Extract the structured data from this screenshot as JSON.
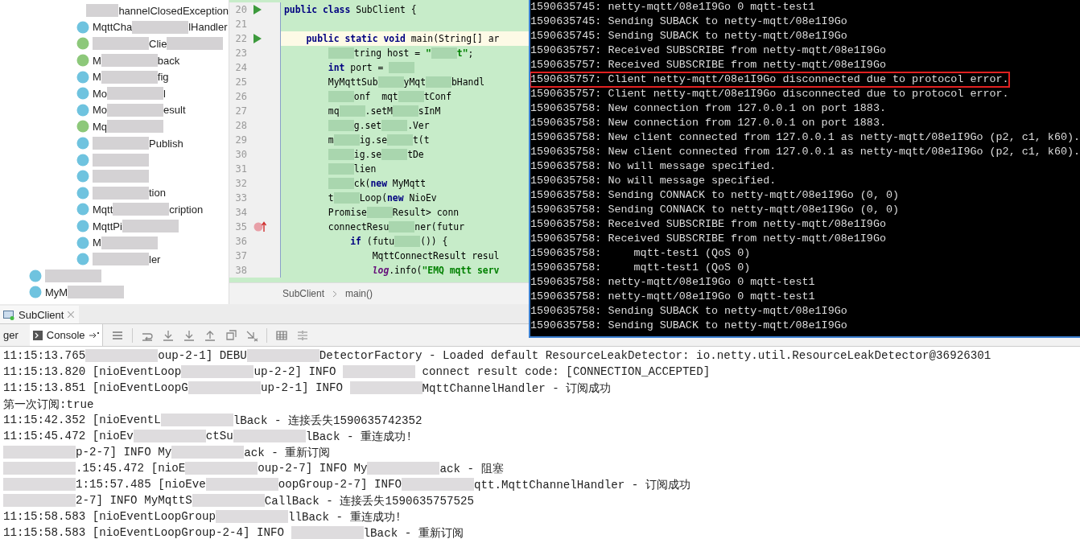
{
  "project_tree": {
    "nested_items": [
      {
        "kind": "none",
        "segments": [
          {
            "kind": "blur"
          },
          {
            "kind": "text",
            "text": "hannelClosedException"
          }
        ]
      },
      {
        "kind": "class",
        "segments": [
          {
            "kind": "text",
            "text": "MqttCha"
          },
          {
            "kind": "blur"
          },
          {
            "kind": "text",
            "text": "lHandler"
          }
        ]
      },
      {
        "kind": "interface",
        "segments": [
          {
            "kind": "blur"
          },
          {
            "kind": "text",
            "text": "Clie"
          },
          {
            "kind": "blur"
          }
        ]
      },
      {
        "kind": "interface",
        "segments": [
          {
            "kind": "text",
            "text": "M"
          },
          {
            "kind": "blur"
          },
          {
            "kind": "text",
            "text": "back"
          }
        ]
      },
      {
        "kind": "class",
        "segments": [
          {
            "kind": "text",
            "text": "M"
          },
          {
            "kind": "blur"
          },
          {
            "kind": "text",
            "text": "fig"
          }
        ]
      },
      {
        "kind": "class",
        "segments": [
          {
            "kind": "text",
            "text": "Mo"
          },
          {
            "kind": "blur"
          },
          {
            "kind": "text",
            "text": "l"
          }
        ]
      },
      {
        "kind": "class",
        "segments": [
          {
            "kind": "text",
            "text": "Mo"
          },
          {
            "kind": "blur"
          },
          {
            "kind": "text",
            "text": "esult"
          }
        ]
      },
      {
        "kind": "interface",
        "segments": [
          {
            "kind": "text",
            "text": "Mq"
          },
          {
            "kind": "blur"
          }
        ]
      },
      {
        "kind": "class",
        "segments": [
          {
            "kind": "blur"
          },
          {
            "kind": "text",
            "text": "Publish"
          }
        ]
      },
      {
        "kind": "class",
        "segments": [
          {
            "kind": "blur"
          }
        ]
      },
      {
        "kind": "class",
        "segments": [
          {
            "kind": "blur"
          }
        ]
      },
      {
        "kind": "class",
        "segments": [
          {
            "kind": "blur"
          },
          {
            "kind": "text",
            "text": "tion"
          }
        ]
      },
      {
        "kind": "class",
        "segments": [
          {
            "kind": "text",
            "text": "Mqtt"
          },
          {
            "kind": "blur"
          },
          {
            "kind": "text",
            "text": "cription"
          }
        ]
      },
      {
        "kind": "class",
        "segments": [
          {
            "kind": "text",
            "text": "MqttPi"
          },
          {
            "kind": "blur"
          }
        ]
      },
      {
        "kind": "class",
        "segments": [
          {
            "kind": "text",
            "text": "M"
          },
          {
            "kind": "blur"
          }
        ]
      },
      {
        "kind": "class",
        "segments": [
          {
            "kind": "blur"
          },
          {
            "kind": "text",
            "text": "ler"
          }
        ]
      }
    ],
    "items": [
      {
        "kind": "class",
        "segments": [
          {
            "kind": "blur"
          }
        ]
      },
      {
        "kind": "class",
        "segments": [
          {
            "kind": "text",
            "text": "MyM"
          },
          {
            "kind": "blur"
          }
        ]
      }
    ]
  },
  "editor": {
    "lines": [
      {
        "number": "20",
        "kind": "run",
        "current": false,
        "segments": [
          {
            "kind": "kw",
            "text": "public class"
          },
          {
            "kind": "text",
            "text": " SubClient {"
          }
        ]
      },
      {
        "number": "21",
        "kind": "plain",
        "current": false
      },
      {
        "number": "22",
        "kind": "run",
        "current": true,
        "segments": [
          {
            "kind": "indent"
          },
          {
            "kind": "kw",
            "text": "public static void"
          },
          {
            "kind": "text",
            "text": " main(String[] ar"
          }
        ]
      },
      {
        "number": "23",
        "kind": "plain",
        "current": false,
        "segments": [
          {
            "kind": "indent"
          },
          {
            "kind": "indent"
          },
          {
            "kind": "blur"
          },
          {
            "kind": "text",
            "text": "tring host = "
          },
          {
            "kind": "str",
            "text": "\""
          },
          {
            "kind": "blur"
          },
          {
            "kind": "str",
            "text": "t\""
          },
          {
            "kind": "text",
            "text": ";"
          }
        ]
      },
      {
        "number": "24",
        "kind": "plain",
        "current": false,
        "segments": [
          {
            "kind": "indent"
          },
          {
            "kind": "indent"
          },
          {
            "kind": "kw",
            "text": "int"
          },
          {
            "kind": "text",
            "text": " port = "
          },
          {
            "kind": "blur"
          }
        ]
      },
      {
        "number": "25",
        "kind": "plain",
        "current": false,
        "segments": [
          {
            "kind": "indent"
          },
          {
            "kind": "indent"
          },
          {
            "kind": "text",
            "text": "MyMqttSub"
          },
          {
            "kind": "blur"
          },
          {
            "kind": "text",
            "text": "yMqt"
          },
          {
            "kind": "blur"
          },
          {
            "kind": "text",
            "text": "bHandl"
          }
        ]
      },
      {
        "number": "26",
        "kind": "plain",
        "current": false,
        "segments": [
          {
            "kind": "indent"
          },
          {
            "kind": "indent"
          },
          {
            "kind": "blur"
          },
          {
            "kind": "text",
            "text": "onf  mqt"
          },
          {
            "kind": "blur"
          },
          {
            "kind": "text",
            "text": "tConf"
          }
        ]
      },
      {
        "number": "27",
        "kind": "plain",
        "current": false,
        "segments": [
          {
            "kind": "indent"
          },
          {
            "kind": "indent"
          },
          {
            "kind": "text",
            "text": "mq"
          },
          {
            "kind": "blur"
          },
          {
            "kind": "text",
            "text": ".setM"
          },
          {
            "kind": "blur"
          },
          {
            "kind": "text",
            "text": "sInM"
          }
        ]
      },
      {
        "number": "28",
        "kind": "plain",
        "current": false,
        "segments": [
          {
            "kind": "indent"
          },
          {
            "kind": "indent"
          },
          {
            "kind": "blur"
          },
          {
            "kind": "text",
            "text": "g.set"
          },
          {
            "kind": "blur"
          },
          {
            "kind": "text",
            "text": ".Ver"
          }
        ]
      },
      {
        "number": "29",
        "kind": "plain",
        "current": false,
        "segments": [
          {
            "kind": "indent"
          },
          {
            "kind": "indent"
          },
          {
            "kind": "text",
            "text": "m"
          },
          {
            "kind": "blur"
          },
          {
            "kind": "text",
            "text": "ig.se"
          },
          {
            "kind": "blur"
          },
          {
            "kind": "text",
            "text": "t(t"
          }
        ]
      },
      {
        "number": "30",
        "kind": "plain",
        "current": false,
        "segments": [
          {
            "kind": "indent"
          },
          {
            "kind": "indent"
          },
          {
            "kind": "blur"
          },
          {
            "kind": "text",
            "text": "ig.se"
          },
          {
            "kind": "blur"
          },
          {
            "kind": "text",
            "text": "tDe"
          }
        ]
      },
      {
        "number": "31",
        "kind": "plain",
        "current": false,
        "segments": [
          {
            "kind": "indent"
          },
          {
            "kind": "indent"
          },
          {
            "kind": "blur"
          },
          {
            "kind": "text",
            "text": "lien"
          }
        ]
      },
      {
        "number": "32",
        "kind": "plain",
        "current": false,
        "segments": [
          {
            "kind": "indent"
          },
          {
            "kind": "indent"
          },
          {
            "kind": "blur"
          },
          {
            "kind": "text",
            "text": "ck("
          },
          {
            "kind": "kw",
            "text": "new"
          },
          {
            "kind": "text",
            "text": " MyMqtt"
          }
        ]
      },
      {
        "number": "33",
        "kind": "plain",
        "current": false,
        "segments": [
          {
            "kind": "indent"
          },
          {
            "kind": "indent"
          },
          {
            "kind": "text",
            "text": "t"
          },
          {
            "kind": "blur"
          },
          {
            "kind": "text",
            "text": "Loop("
          },
          {
            "kind": "kw",
            "text": "new"
          },
          {
            "kind": "text",
            "text": " NioEv"
          }
        ]
      },
      {
        "number": "34",
        "kind": "plain",
        "current": false,
        "segments": [
          {
            "kind": "indent"
          },
          {
            "kind": "indent"
          },
          {
            "kind": "text",
            "text": "Promise"
          },
          {
            "kind": "blur"
          },
          {
            "kind": "text",
            "text": "Result> conn"
          }
        ]
      },
      {
        "number": "35",
        "kind": "lambda",
        "current": false,
        "segments": [
          {
            "kind": "indent"
          },
          {
            "kind": "indent"
          },
          {
            "kind": "text",
            "text": "connectResu"
          },
          {
            "kind": "blur"
          },
          {
            "kind": "text",
            "text": "ner(futur"
          }
        ]
      },
      {
        "number": "36",
        "kind": "plain",
        "current": false,
        "segments": [
          {
            "kind": "indent"
          },
          {
            "kind": "indent"
          },
          {
            "kind": "indent"
          },
          {
            "kind": "kw",
            "text": "if"
          },
          {
            "kind": "text",
            "text": " (futu"
          },
          {
            "kind": "blur"
          },
          {
            "kind": "text",
            "text": "()) {"
          }
        ]
      },
      {
        "number": "37",
        "kind": "plain",
        "current": false,
        "segments": [
          {
            "kind": "indent"
          },
          {
            "kind": "indent"
          },
          {
            "kind": "indent"
          },
          {
            "kind": "indent"
          },
          {
            "kind": "text",
            "text": "MqttConnectResult resul"
          }
        ]
      },
      {
        "number": "38",
        "kind": "plain",
        "current": false,
        "segments": [
          {
            "kind": "indent"
          },
          {
            "kind": "indent"
          },
          {
            "kind": "indent"
          },
          {
            "kind": "indent"
          },
          {
            "kind": "field",
            "text": "log"
          },
          {
            "kind": "text",
            "text": ".info("
          },
          {
            "kind": "str",
            "text": "\"EMQ mqtt serv"
          }
        ]
      }
    ],
    "breadcrumbs": [
      "SubClient",
      "main()"
    ]
  },
  "terminal": {
    "lines": [
      {
        "text": "1590635745: netty-mqtt/08e1I9Go 0 mqtt-test1",
        "highlighted": false
      },
      {
        "text": "1590635745: Sending SUBACK to netty-mqtt/08e1I9Go",
        "highlighted": false
      },
      {
        "text": "1590635745: Sending SUBACK to netty-mqtt/08e1I9Go",
        "highlighted": false
      },
      {
        "text": "1590635757: Received SUBSCRIBE from netty-mqtt/08e1I9Go",
        "highlighted": false
      },
      {
        "text": "1590635757: Received SUBSCRIBE from netty-mqtt/08e1I9Go",
        "highlighted": false
      },
      {
        "text": "1590635757: Client netty-mqtt/08e1I9Go disconnected due to protocol error.",
        "highlighted": true
      },
      {
        "text": "1590635757: Client netty-mqtt/08e1I9Go disconnected due to protocol error.",
        "highlighted": false
      },
      {
        "text": "1590635758: New connection from 127.0.0.1 on port 1883.",
        "highlighted": false
      },
      {
        "text": "1590635758: New connection from 127.0.0.1 on port 1883.",
        "highlighted": false
      },
      {
        "text": "1590635758: New client connected from 127.0.0.1 as netty-mqtt/08e1I9Go (p2, c1, k60).",
        "highlighted": false
      },
      {
        "text": "1590635758: New client connected from 127.0.0.1 as netty-mqtt/08e1I9Go (p2, c1, k60).",
        "highlighted": false
      },
      {
        "text": "1590635758: No will message specified.",
        "highlighted": false
      },
      {
        "text": "1590635758: No will message specified.",
        "highlighted": false
      },
      {
        "text": "1590635758: Sending CONNACK to netty-mqtt/08e1I9Go (0, 0)",
        "highlighted": false
      },
      {
        "text": "1590635758: Sending CONNACK to netty-mqtt/08e1I9Go (0, 0)",
        "highlighted": false
      },
      {
        "text": "1590635758: Received SUBSCRIBE from netty-mqtt/08e1I9Go",
        "highlighted": false
      },
      {
        "text": "1590635758: Received SUBSCRIBE from netty-mqtt/08e1I9Go",
        "highlighted": false
      },
      {
        "text": "1590635758:     mqtt-test1 (QoS 0)",
        "highlighted": false
      },
      {
        "text": "1590635758:     mqtt-test1 (QoS 0)",
        "highlighted": false
      },
      {
        "text": "1590635758: netty-mqtt/08e1I9Go 0 mqtt-test1",
        "highlighted": false
      },
      {
        "text": "1590635758: netty-mqtt/08e1I9Go 0 mqtt-test1",
        "highlighted": false
      },
      {
        "text": "1590635758: Sending SUBACK to netty-mqtt/08e1I9Go",
        "highlighted": false
      },
      {
        "text": "1590635758: Sending SUBACK to netty-mqtt/08e1I9Go",
        "highlighted": false
      }
    ]
  },
  "run_panel": {
    "tab": "SubClient",
    "tool_tabs": [
      {
        "label": "ger",
        "selected": false
      },
      {
        "label": "Console",
        "selected": true
      }
    ],
    "console_lines": [
      [
        {
          "kind": "text",
          "text": "11:15:13.765"
        },
        {
          "kind": "blur"
        },
        {
          "kind": "text",
          "text": "oup-2-1] DEBU"
        },
        {
          "kind": "blur"
        },
        {
          "kind": "text",
          "text": "DetectorFactory - Loaded default ResourceLeakDetector: io.netty.util.ResourceLeakDetector@36926301"
        }
      ],
      [
        {
          "kind": "text",
          "text": "11:15:13.820 [nioEventLoop"
        },
        {
          "kind": "blur"
        },
        {
          "kind": "text",
          "text": "up-2-2] INFO "
        },
        {
          "kind": "blur"
        },
        {
          "kind": "text",
          "text": " connect result code: [CONNECTION_ACCEPTED]"
        }
      ],
      [
        {
          "kind": "text",
          "text": "11:15:13.851 [nioEventLoopG"
        },
        {
          "kind": "blur"
        },
        {
          "kind": "text",
          "text": "up-2-1] INFO "
        },
        {
          "kind": "blur"
        },
        {
          "kind": "text",
          "text": "MqttChannelHandler - 订阅成功"
        }
      ],
      [
        {
          "kind": "text",
          "text": "第一次订阅:true"
        }
      ],
      [
        {
          "kind": "text",
          "text": "11:15:42.352 [nioEventL"
        },
        {
          "kind": "blur"
        },
        {
          "kind": "text",
          "text": "lBack - 连接丢失1590635742352"
        }
      ],
      [
        {
          "kind": "text",
          "text": "11:15:45.472 [nioEv"
        },
        {
          "kind": "blur"
        },
        {
          "kind": "text",
          "text": "ctSu"
        },
        {
          "kind": "blur"
        },
        {
          "kind": "text",
          "text": "lBack - 重连成功!"
        }
      ],
      [
        {
          "kind": "blur"
        },
        {
          "kind": "text",
          "text": "p-2-7] INFO My"
        },
        {
          "kind": "blur"
        },
        {
          "kind": "text",
          "text": "ack - 重新订阅"
        }
      ],
      [
        {
          "kind": "blur"
        },
        {
          "kind": "text",
          "text": ".15:45.472 [nioE"
        },
        {
          "kind": "blur"
        },
        {
          "kind": "text",
          "text": "oup-2-7] INFO My"
        },
        {
          "kind": "blur"
        },
        {
          "kind": "text",
          "text": "ack - 阻塞"
        }
      ],
      [
        {
          "kind": "blur"
        },
        {
          "kind": "text",
          "text": "1:15:57.485 [nioEve"
        },
        {
          "kind": "blur"
        },
        {
          "kind": "text",
          "text": "oopGroup-2-7] INFO"
        },
        {
          "kind": "blur"
        },
        {
          "kind": "text",
          "text": "qtt.MqttChannelHandler - 订阅成功"
        }
      ],
      [
        {
          "kind": "blur"
        },
        {
          "kind": "text",
          "text": "2-7] INFO MyMqttS"
        },
        {
          "kind": "blur"
        },
        {
          "kind": "text",
          "text": "CallBack - 连接丢失1590635757525"
        }
      ],
      [
        {
          "kind": "text",
          "text": "11:15:58.583 [nioEventLoopGroup"
        },
        {
          "kind": "blur"
        },
        {
          "kind": "text",
          "text": "llBack - 重连成功!"
        }
      ],
      [
        {
          "kind": "text",
          "text": "11:15:58.583 [nioEventLoopGroup-2-4] INFO "
        },
        {
          "kind": "blur"
        },
        {
          "kind": "text",
          "text": "lBack - 重新订阅"
        }
      ]
    ]
  }
}
